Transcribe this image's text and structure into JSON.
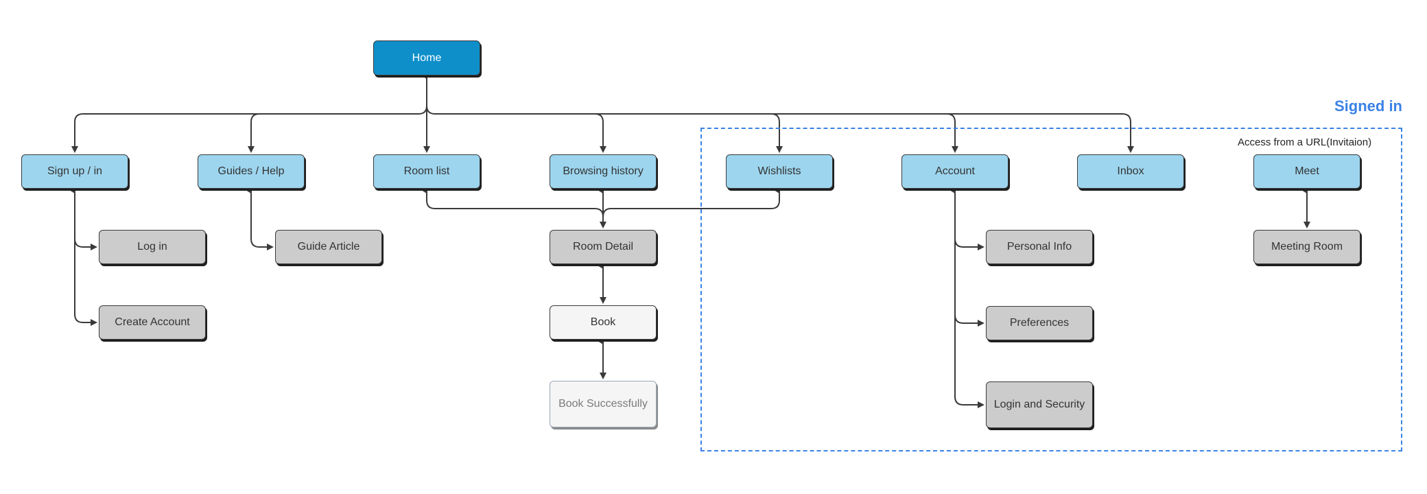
{
  "diagram": {
    "type": "sitemap",
    "colors": {
      "primary": "#0e8fca",
      "section": "#9dd5ee",
      "page": "#cccccc",
      "action": "#f5f5f5",
      "region_border": "#3b82e6",
      "connector": "#3a3a3a"
    },
    "region": {
      "title": "Signed in",
      "note": "Access from a URL(Invitaion)"
    },
    "nodes": {
      "home": "Home",
      "signup": "Sign up / in",
      "guides": "Guides / Help",
      "roomlist": "Room list",
      "history": "Browsing history",
      "wishlists": "Wishlists",
      "account": "Account",
      "inbox": "Inbox",
      "meet": "Meet",
      "login": "Log in",
      "create_account": "Create Account",
      "guide_article": "Guide Article",
      "room_detail": "Room Detail",
      "book": "Book",
      "book_success": "Book Successfully",
      "personal_info": "Personal Info",
      "preferences": "Preferences",
      "login_security": "Login and Security",
      "meeting_room": "Meeting Room"
    },
    "edges": [
      [
        "home",
        "signup"
      ],
      [
        "home",
        "guides"
      ],
      [
        "home",
        "roomlist"
      ],
      [
        "home",
        "history"
      ],
      [
        "home",
        "wishlists"
      ],
      [
        "home",
        "account"
      ],
      [
        "home",
        "inbox"
      ],
      [
        "signup",
        "login"
      ],
      [
        "signup",
        "create_account"
      ],
      [
        "guides",
        "guide_article"
      ],
      [
        "roomlist",
        "room_detail"
      ],
      [
        "history",
        "room_detail"
      ],
      [
        "wishlists",
        "room_detail"
      ],
      [
        "room_detail",
        "book"
      ],
      [
        "book",
        "book_success"
      ],
      [
        "account",
        "personal_info"
      ],
      [
        "account",
        "preferences"
      ],
      [
        "account",
        "login_security"
      ],
      [
        "meet",
        "meeting_room"
      ]
    ]
  }
}
